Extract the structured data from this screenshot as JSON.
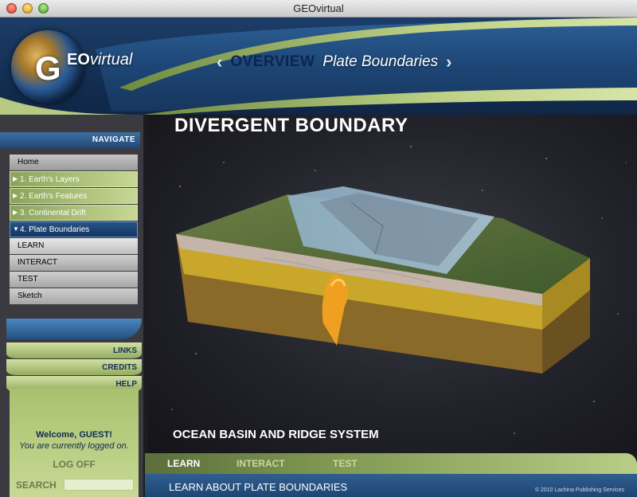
{
  "window": {
    "title": "GEOvirtual"
  },
  "logo": {
    "letter": "G",
    "eo": "EO",
    "virtual": "virtual"
  },
  "header": {
    "section": "OVERVIEW",
    "topic": "Plate Boundaries",
    "prev_icon": "chevron-left-icon",
    "next_icon": "chevron-right-icon"
  },
  "sidebar": {
    "navigate_label": "NAVIGATE",
    "items": [
      {
        "label": "Home"
      },
      {
        "label": "1. Earth's Layers"
      },
      {
        "label": "2. Earth's Features"
      },
      {
        "label": "3. Continental Drift"
      },
      {
        "label": "4. Plate Boundaries"
      },
      {
        "label": "LEARN"
      },
      {
        "label": "INTERACT"
      },
      {
        "label": "TEST"
      },
      {
        "label": "Sketch"
      }
    ],
    "links": [
      "LINKS",
      "CREDITS",
      "HELP"
    ],
    "welcome": "Welcome, GUEST!",
    "logged_in": "You are currently logged on.",
    "logoff": "LOG OFF",
    "search_label": "SEARCH",
    "search_value": ""
  },
  "main": {
    "title": "DIVERGENT BOUNDARY",
    "caption": "OCEAN BASIN AND RIDGE SYSTEM"
  },
  "tabs": [
    "LEARN",
    "INTERACT",
    "TEST"
  ],
  "footer": {
    "text": "LEARN ABOUT PLATE BOUNDARIES",
    "copyright": "© 2010 Lachina Publishing Services"
  },
  "colors": {
    "accent_green": "#9db466",
    "navy": "#1b3a63",
    "active_blue": "#1f4777"
  }
}
